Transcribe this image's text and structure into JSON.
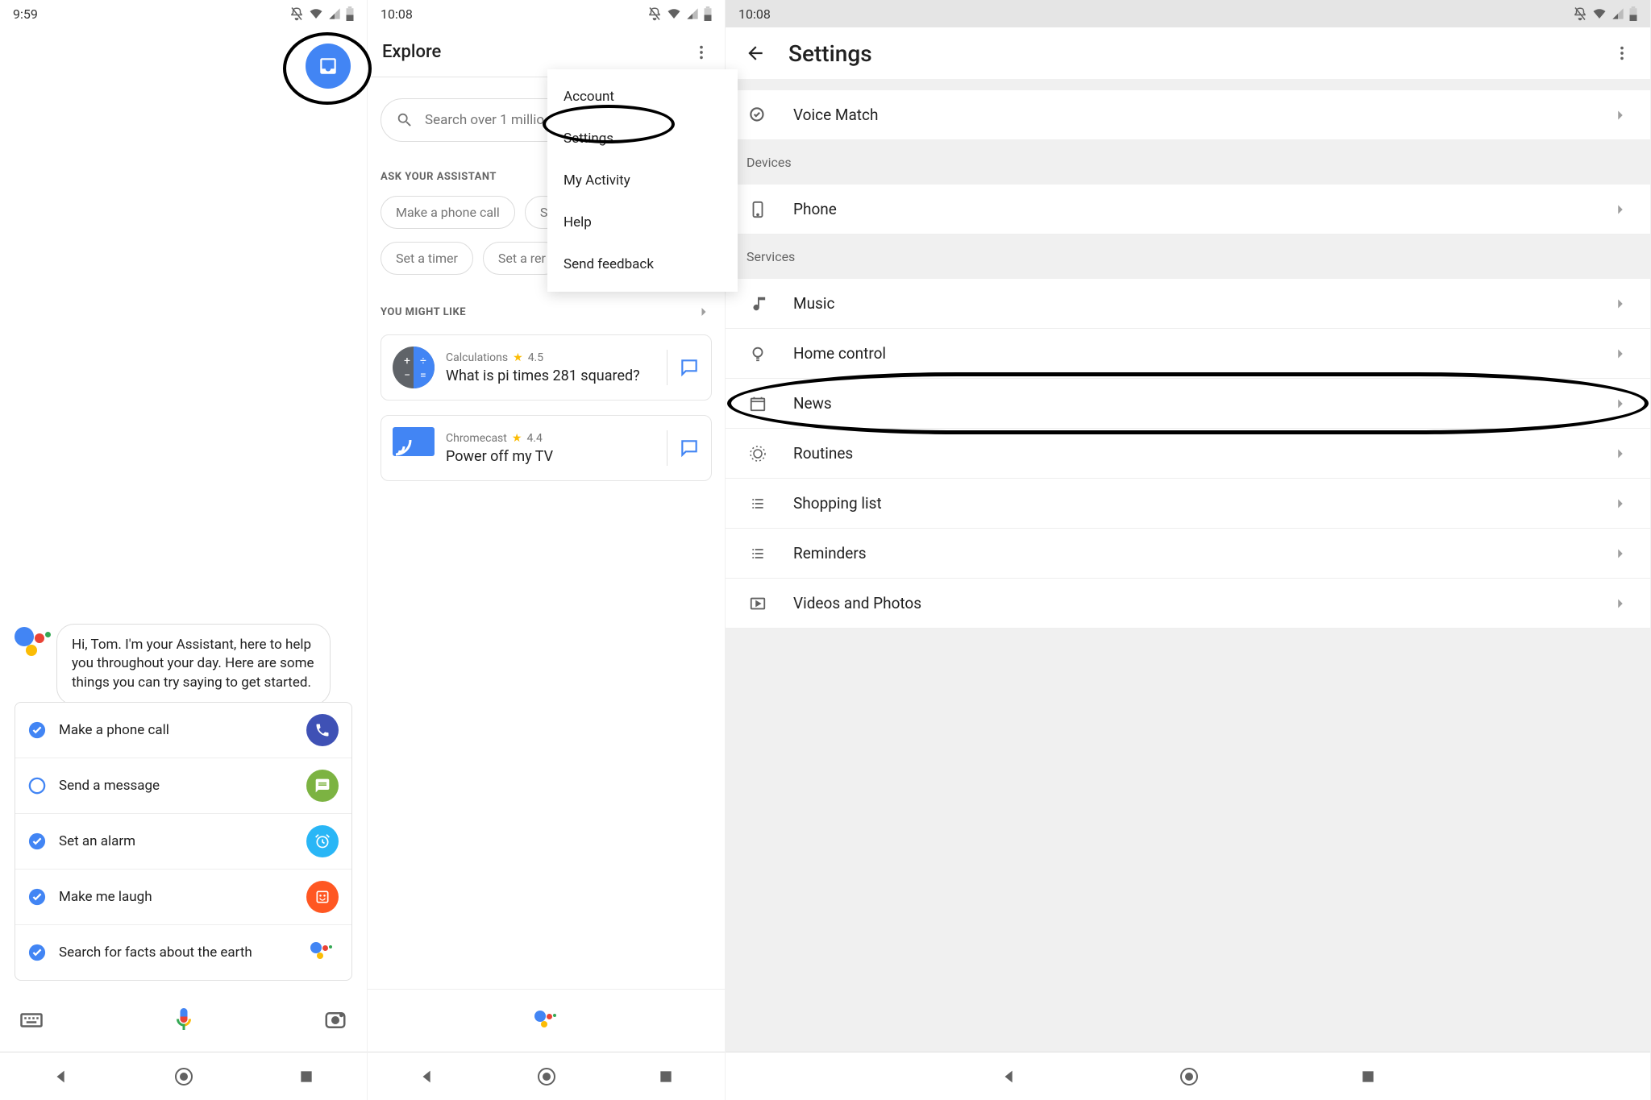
{
  "screen1": {
    "time": "9:59",
    "intro": "Hi, Tom. I'm your Assistant, here to help you throughout your day. Here are some things you can try saying to get started.",
    "suggestions": [
      {
        "label": "Make a phone call",
        "checked": true,
        "iconBg": "#3F51B5"
      },
      {
        "label": "Send a message",
        "checked": false,
        "iconBg": "#7CB342"
      },
      {
        "label": "Set an alarm",
        "checked": true,
        "iconBg": "#29B6F6"
      },
      {
        "label": "Make me laugh",
        "checked": true,
        "iconBg": "#FF5722"
      },
      {
        "label": "Search for facts about the earth",
        "checked": true,
        "iconBg": "transparent"
      }
    ]
  },
  "screen2": {
    "time": "10:08",
    "title": "Explore",
    "searchPlaceholder": "Search over 1 millio",
    "askLabel": "ASK YOUR ASSISTANT",
    "chips": [
      "Make a phone call",
      "S",
      "Set a timer",
      "Set a rer"
    ],
    "ymlLabel": "YOU MIGHT LIKE",
    "cards": [
      {
        "category": "Calculations",
        "rating": "4.5",
        "title": "What is pi times 281 squared?"
      },
      {
        "category": "Chromecast",
        "rating": "4.4",
        "title": "Power off my TV"
      }
    ],
    "menu": [
      "Account",
      "Settings",
      "My Activity",
      "Help",
      "Send feedback"
    ]
  },
  "screen3": {
    "time": "10:08",
    "title": "Settings",
    "topRow": "Voice Match",
    "sections": [
      {
        "label": "Devices",
        "rows": [
          {
            "label": "Phone",
            "icon": "phone"
          }
        ]
      },
      {
        "label": "Services",
        "rows": [
          {
            "label": "Music",
            "icon": "music"
          },
          {
            "label": "Home control",
            "icon": "bulb"
          },
          {
            "label": "News",
            "icon": "news",
            "circled": true
          },
          {
            "label": "Routines",
            "icon": "routines"
          },
          {
            "label": "Shopping list",
            "icon": "list"
          },
          {
            "label": "Reminders",
            "icon": "list"
          },
          {
            "label": "Videos and Photos",
            "icon": "video"
          }
        ]
      }
    ]
  }
}
